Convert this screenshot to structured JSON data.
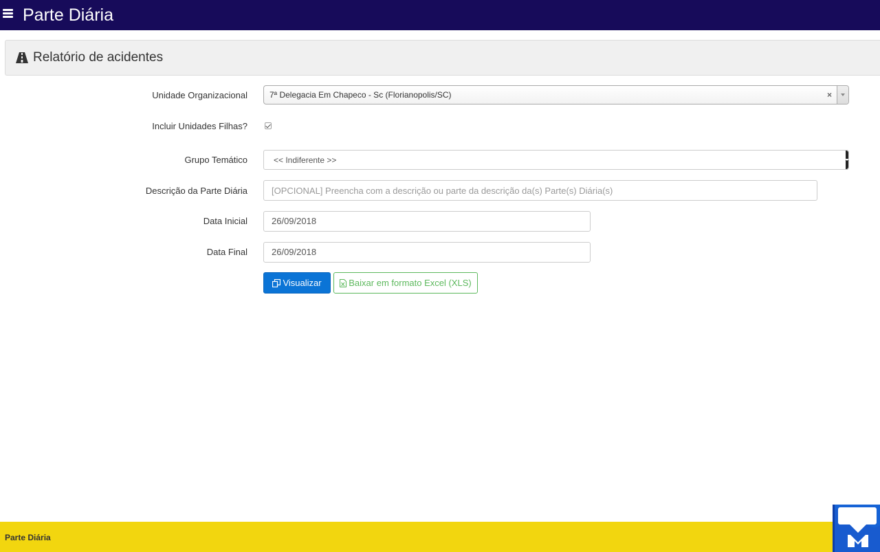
{
  "app": {
    "title": "Parte Diária"
  },
  "panel": {
    "title": "Relatório de acidentes"
  },
  "form": {
    "unidade": {
      "label": "Unidade Organizacional",
      "value": "7ª Delegacia Em Chapeco - Sc (Florianopolis/SC)",
      "clear": "×"
    },
    "incluir": {
      "label": "Incluir Unidades Filhas?",
      "checked": true
    },
    "grupo": {
      "label": "Grupo Temático",
      "value": "<< Indiferente >>"
    },
    "descricao": {
      "label": "Descrição da Parte Diária",
      "placeholder": "[OPCIONAL] Preencha com a descrição ou parte da descrição da(s) Parte(s) Diária(s)"
    },
    "data_inicial": {
      "label": "Data Inicial",
      "value": "26/09/2018"
    },
    "data_final": {
      "label": "Data Final",
      "value": "26/09/2018"
    }
  },
  "buttons": {
    "visualizar": "Visualizar",
    "excel": "Baixar em formato Excel (XLS)"
  },
  "footer": {
    "text": "Parte Diária"
  },
  "colors": {
    "navbar": "#170b5a",
    "footer": "#f2d60f",
    "primary": "#0b74d6",
    "success": "#5cb85c"
  },
  "icons": {
    "menu": "hamburger-icon",
    "panel": "road-icon",
    "visualizar": "copy-icon",
    "excel": "file-excel-icon",
    "chat": "chat-widget-icon"
  }
}
